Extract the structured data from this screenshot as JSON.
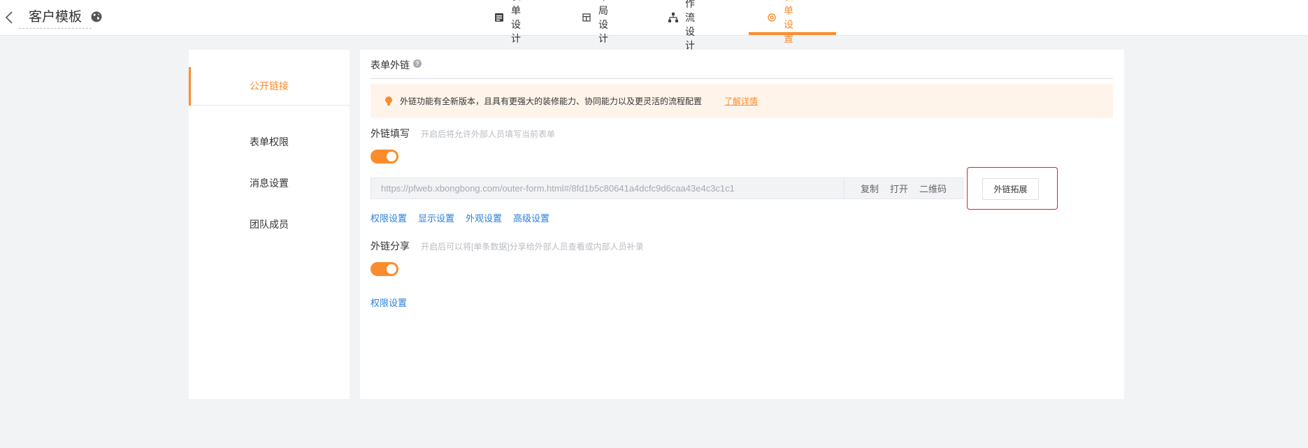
{
  "header": {
    "title": "客户模板",
    "tabs": [
      {
        "label": "表单设计",
        "icon": "form-icon"
      },
      {
        "label": "布局设计",
        "icon": "layout-icon"
      },
      {
        "label": "工作流设计",
        "icon": "workflow-icon"
      },
      {
        "label": "表单设置",
        "icon": "settings-icon",
        "active": true
      }
    ]
  },
  "sidebar": {
    "items": [
      {
        "label": "公开链接",
        "active": true
      },
      {
        "label": "表单权限"
      },
      {
        "label": "消息设置"
      },
      {
        "label": "团队成员"
      }
    ]
  },
  "main": {
    "section_title": "表单外链",
    "notice": {
      "text": "外链功能有全新版本，且具有更强大的装修能力、协同能力以及更灵活的流程配置",
      "link": "了解详情"
    },
    "external_fill": {
      "label": "外链填写",
      "hint": "开启后将允许外部人员填写当前表单",
      "enabled": true,
      "url": "https://pfweb.xbongbong.com/outer-form.html#/8fd1b5c80641a4dcfc9d6caa43e4c3c1c1",
      "actions": [
        "复制",
        "打开",
        "二维码"
      ],
      "extend_button": "外链拓展",
      "links": [
        "权限设置",
        "显示设置",
        "外观设置",
        "高级设置"
      ]
    },
    "external_share": {
      "label": "外链分享",
      "hint": "开启后可以将[单条数据]分享给外部人员查看或内部人员补录",
      "enabled": true,
      "links": [
        "权限设置"
      ]
    }
  },
  "colors": {
    "accent": "#fa8c2e",
    "link": "#2b7fd9",
    "highlight_border": "#d9242b",
    "notice_bg": "#fff4ea"
  }
}
